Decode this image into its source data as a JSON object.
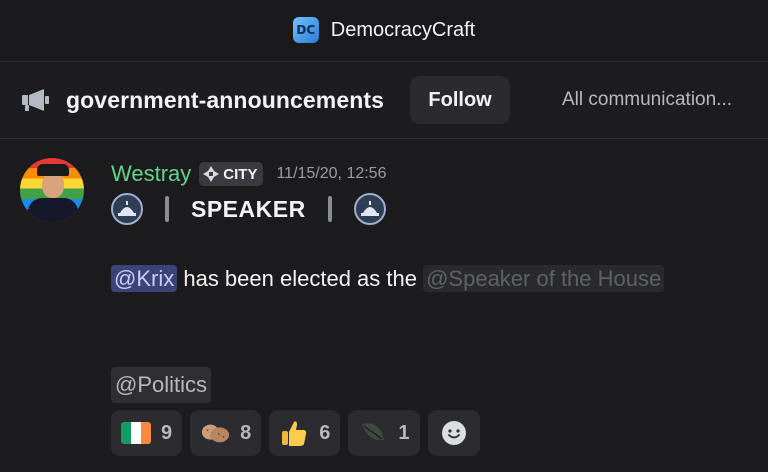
{
  "window": {
    "server_name": "DemocracyCraft",
    "server_logo": "DC"
  },
  "channel": {
    "name": "government-announcements",
    "follow_label": "Follow",
    "topic": "All communication..."
  },
  "message": {
    "author": "Westray",
    "author_color": "#64d38a",
    "tag": "CITY",
    "timestamp": "11/15/20, 12:56",
    "speaker_label": "SPEAKER",
    "mention_user": "@Krix",
    "body_mid": " has been elected as the ",
    "mention_role": "@Speaker of the House",
    "mention_role2": "@Politics"
  },
  "reactions": [
    {
      "emoji": "ireland-flag",
      "count": "9"
    },
    {
      "emoji": "potato",
      "count": "8"
    },
    {
      "emoji": "thumbs-up",
      "count": "6"
    },
    {
      "emoji": "leaf",
      "count": "1"
    }
  ],
  "add_reaction_icon": "add-reaction-smiley"
}
